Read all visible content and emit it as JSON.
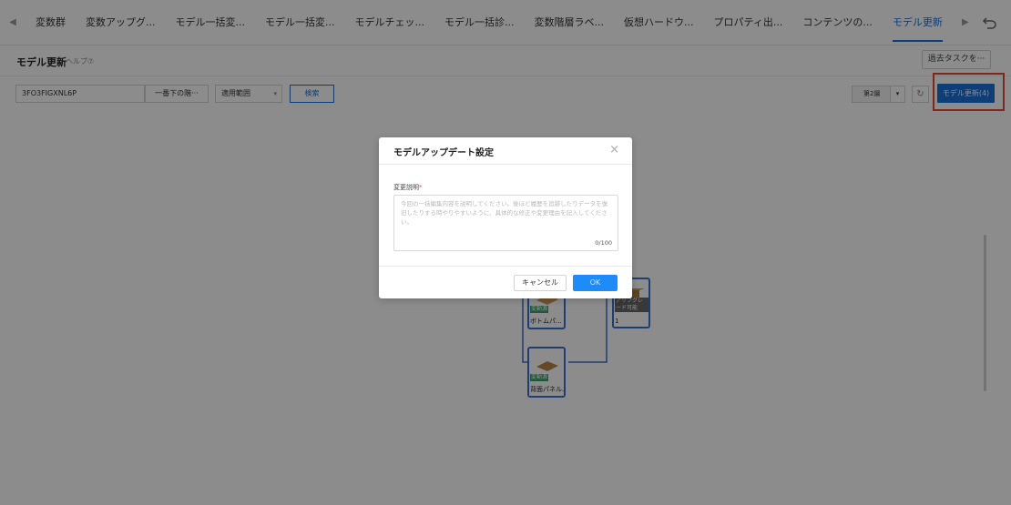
{
  "tabs": {
    "prev_icon": "chevron-left-icon",
    "next_icon": "chevron-right-icon",
    "items": [
      {
        "label": "変数群"
      },
      {
        "label": "変数アップグ..."
      },
      {
        "label": "モデル一括変..."
      },
      {
        "label": "モデル一括変..."
      },
      {
        "label": "モデルチェッ..."
      },
      {
        "label": "モデル一括診..."
      },
      {
        "label": "変数階層ラベ..."
      },
      {
        "label": "仮想ハードウ..."
      },
      {
        "label": "プロパティ出..."
      },
      {
        "label": "コンテンツの..."
      },
      {
        "label": "モデル更新"
      }
    ],
    "active_index": 10
  },
  "header": {
    "title": "モデル更新",
    "help": "ヘルプ⑦",
    "past_tasks_button": "過去タスクを···"
  },
  "toolbar": {
    "search_value": "3FO3FIGXNL6P",
    "level_select": "一番下の階···",
    "scope_select": "適用範囲",
    "search_button": "検索",
    "layer_select": "第2層",
    "update_button": "モデル更新(4)"
  },
  "graph": {
    "nodes": [
      {
        "badge": "変動源",
        "label": "ボトムパ..."
      },
      {
        "badge": "変動源",
        "label": "背面パネル..."
      },
      {
        "badge": "アップグレード可能",
        "label": "1"
      }
    ]
  },
  "modal": {
    "title": "モデルアップデート設定",
    "field_label": "変更説明",
    "required_mark": "*",
    "placeholder": "今回の一括編集内容を説明してください。後ほど履歴を追跡したりデータを復旧したりする時やりやすいように、具体的な修正や変更理由を記入してください。",
    "counter": "0/100",
    "cancel": "キャンセル",
    "ok": "OK"
  },
  "colors": {
    "accent": "#1d6fd8",
    "highlight": "#e04a3c",
    "badge_green": "#3aa36a"
  }
}
